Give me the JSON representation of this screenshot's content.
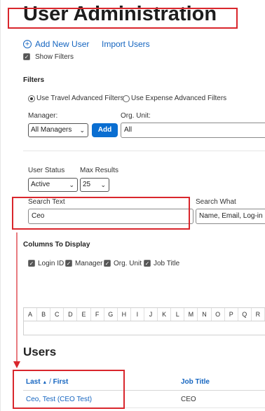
{
  "page": {
    "title": "User Administration"
  },
  "actions": {
    "add_new_user": "Add New User",
    "import_users": "Import Users",
    "show_filters": "Show Filters"
  },
  "filters": {
    "title": "Filters",
    "radio_travel": "Use Travel Advanced Filters",
    "radio_expense": "Use Expense Advanced Filters",
    "manager_label": "Manager:",
    "manager_value": "All Managers",
    "add_button": "Add",
    "org_unit_label": "Org. Unit:",
    "org_unit_value": "All",
    "user_status_label": "User Status",
    "user_status_value": "Active",
    "max_results_label": "Max Results",
    "max_results_value": "25",
    "search_text_label": "Search Text",
    "search_text_value": "Ceo",
    "search_what_label": "Search What",
    "search_what_value": "Name, Email, Log-in"
  },
  "columns_display": {
    "title": "Columns To Display",
    "items": [
      "Login ID",
      "Manager",
      "Org. Unit",
      "Job Title"
    ]
  },
  "alphabet": [
    "A",
    "B",
    "C",
    "D",
    "E",
    "F",
    "G",
    "H",
    "I",
    "J",
    "K",
    "L",
    "M",
    "N",
    "O",
    "P",
    "Q",
    "R"
  ],
  "users": {
    "title": "Users",
    "col_last": "Last",
    "col_sep": "/",
    "col_first": "First",
    "col_job": "Job Title",
    "rows": [
      {
        "name": "Ceo, Test (CEO Test)",
        "job_title": "CEO"
      }
    ]
  },
  "colors": {
    "accent": "#0a6ed1",
    "link": "#1565c0",
    "highlight": "#d9262c"
  }
}
